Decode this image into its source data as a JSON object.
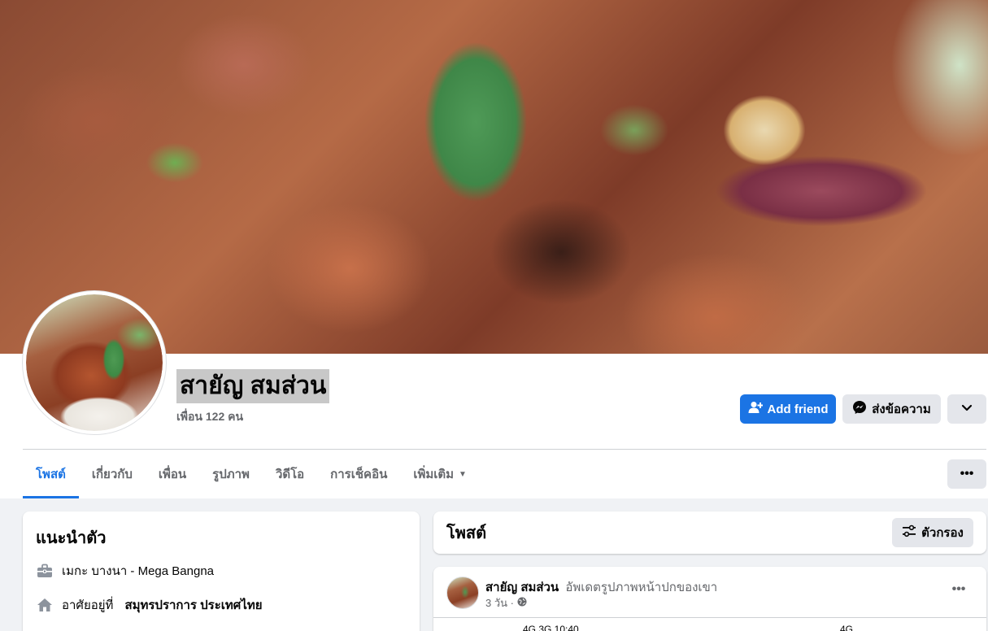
{
  "profile": {
    "name": "สายัญ สมส่วน",
    "friends_count": "เพื่อน 122 คน"
  },
  "actions": {
    "add_friend": "Add friend",
    "message": "ส่งข้อความ"
  },
  "tabs": [
    {
      "label": "โพสต์",
      "active": true
    },
    {
      "label": "เกี่ยวกับ"
    },
    {
      "label": "เพื่อน"
    },
    {
      "label": "รูปภาพ"
    },
    {
      "label": "วิดีโอ"
    },
    {
      "label": "การเช็คอิน"
    },
    {
      "label": "เพิ่มเติม"
    }
  ],
  "intro": {
    "title": "แนะนำตัว",
    "work": "เมกะ บางนา - Mega Bangna",
    "lives_prefix": "อาศัยอยู่ที่",
    "lives_place": "สมุทรปราการ ประเทศไทย"
  },
  "posts_section": {
    "title": "โพสต์",
    "filter_label": "ตัวกรอง"
  },
  "post": {
    "author": "สายัญ สมส่วน",
    "action": "อัพเดตรูปภาพหน้าปกของเขา",
    "time": "3 วัน ·",
    "preview_left": "4G  3G  10:40",
    "preview_right": "4G"
  },
  "colors": {
    "primary": "#1b74e4",
    "secondary_bg": "#e4e6eb",
    "page_bg": "#f0f2f5"
  }
}
